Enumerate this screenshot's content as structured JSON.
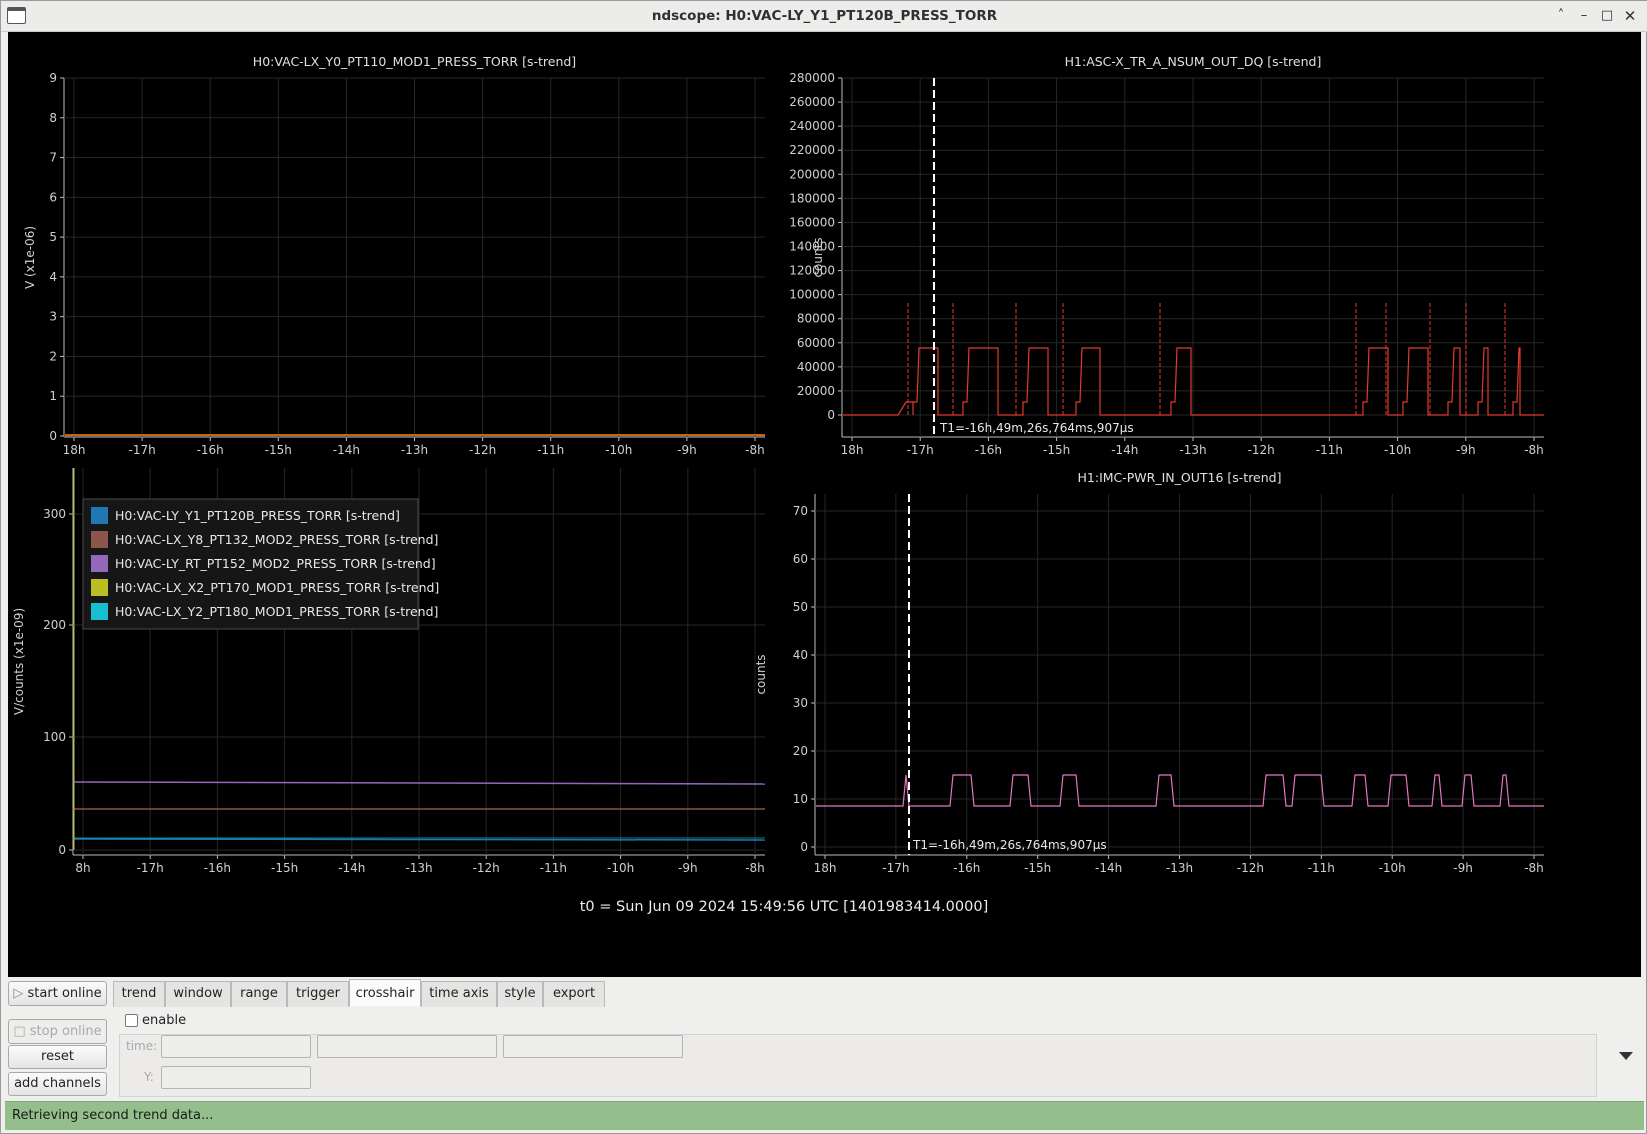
{
  "window": {
    "title": "ndscope: H0:VAC-LY_Y1_PT120B_PRESS_TORR",
    "controls": [
      "chevron-up",
      "minimize",
      "maximize",
      "close"
    ]
  },
  "colors": {
    "plot_bg": "#000000",
    "grid": "#262626",
    "axis": "#bdbdbd",
    "orange": "#ff7f0e",
    "red": "#e03b2c",
    "pink": "#e377c2",
    "blue": "#1f77b4",
    "brown": "#8c564b",
    "purple": "#9467bd",
    "olive": "#bcbd22",
    "cyan": "#17becf",
    "status_bg": "#94bf8c"
  },
  "plots": {
    "top_left": {
      "title": "H0:VAC-LX_Y0_PT110_MOD1_PRESS_TORR [s-trend]",
      "ylabel": "V (x1e-06)",
      "yticks": [
        "9",
        "8",
        "7",
        "6",
        "5",
        "4",
        "3",
        "2",
        "1",
        "0"
      ],
      "xticks": [
        "18h",
        "-17h",
        "-16h",
        "-15h",
        "-14h",
        "-13h",
        "-12h",
        "-11h",
        "-10h",
        "-9h",
        "-8h"
      ]
    },
    "top_right": {
      "title": "H1:ASC-X_TR_A_NSUM_OUT_DQ [s-trend]",
      "ylabel": "counts",
      "yticks": [
        "280000",
        "260000",
        "240000",
        "220000",
        "200000",
        "180000",
        "160000",
        "140000",
        "120000",
        "100000",
        "80000",
        "60000",
        "40000",
        "20000",
        "0"
      ],
      "xticks": [
        "18h",
        "-17h",
        "-16h",
        "-15h",
        "-14h",
        "-13h",
        "-12h",
        "-11h",
        "-10h",
        "-9h",
        "-8h"
      ],
      "cursor_label": "T1=-16h,49m,26s,764ms,907µs"
    },
    "bottom_left": {
      "ylabel": "V/counts (x1e-09)",
      "yticks": [
        "300",
        "200",
        "100",
        "0"
      ],
      "xticks": [
        "8h",
        "-17h",
        "-16h",
        "-15h",
        "-14h",
        "-13h",
        "-12h",
        "-11h",
        "-10h",
        "-9h",
        "-8h"
      ],
      "legend": [
        {
          "label": "H0:VAC-LY_Y1_PT120B_PRESS_TORR [s-trend]",
          "color": "#1f77b4"
        },
        {
          "label": "H0:VAC-LX_Y8_PT132_MOD2_PRESS_TORR [s-trend]",
          "color": "#8c564b"
        },
        {
          "label": "H0:VAC-LY_RT_PT152_MOD2_PRESS_TORR [s-trend]",
          "color": "#9467bd"
        },
        {
          "label": "H0:VAC-LX_X2_PT170_MOD1_PRESS_TORR [s-trend]",
          "color": "#bcbd22"
        },
        {
          "label": "H0:VAC-LX_Y2_PT180_MOD1_PRESS_TORR [s-trend]",
          "color": "#17becf"
        }
      ]
    },
    "bottom_right": {
      "title": "H1:IMC-PWR_IN_OUT16 [s-trend]",
      "ylabel": "counts",
      "yticks": [
        "70",
        "60",
        "50",
        "40",
        "30",
        "20",
        "10",
        "0"
      ],
      "xticks": [
        "18h",
        "-17h",
        "-16h",
        "-15h",
        "-14h",
        "-13h",
        "-12h",
        "-11h",
        "-10h",
        "-9h",
        "-8h"
      ],
      "cursor_label": "T1=-16h,49m,26s,764ms,907µs"
    },
    "t0_label": "t0 = Sun Jun 09 2024 15:49:56 UTC [1401983414.0000]"
  },
  "side_buttons": {
    "start_online": "start online",
    "stop_online": "stop online",
    "reset": "reset",
    "add_channels": "add channels"
  },
  "tabs": [
    "trend",
    "window",
    "range",
    "trigger",
    "crosshair",
    "time axis",
    "style",
    "export"
  ],
  "active_tab": "crosshair",
  "crosshair": {
    "enable_label": "enable",
    "time_label": "time:",
    "y_label": "Y:"
  },
  "status": "Retrieving second trend data..."
}
